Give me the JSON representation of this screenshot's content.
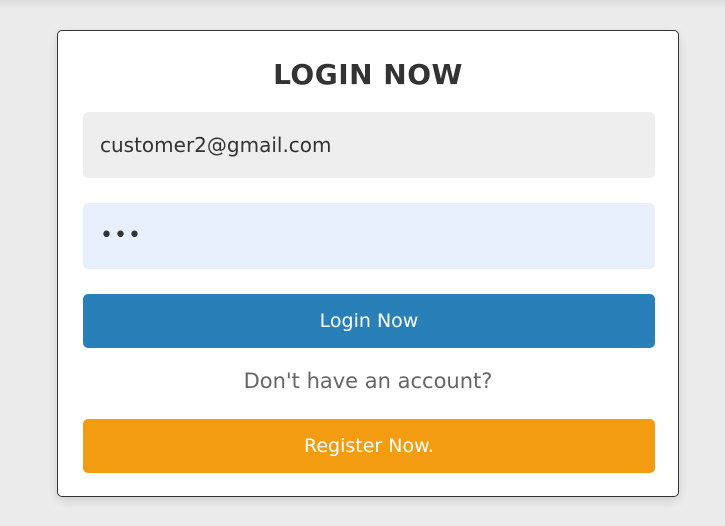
{
  "form": {
    "title": "LOGIN NOW",
    "email_value": "customer2@gmail.com",
    "password_value": "•••",
    "login_label": "Login Now",
    "account_prompt": "Don't have an account?",
    "register_label": "Register Now."
  },
  "colors": {
    "background": "#ececec",
    "card": "#ffffff",
    "email_field_bg": "#eeeeee",
    "password_field_bg": "#e8f0fe",
    "login_button": "#2980b9",
    "register_button": "#f39c12",
    "title_text": "#333333",
    "prompt_text": "#666666"
  }
}
